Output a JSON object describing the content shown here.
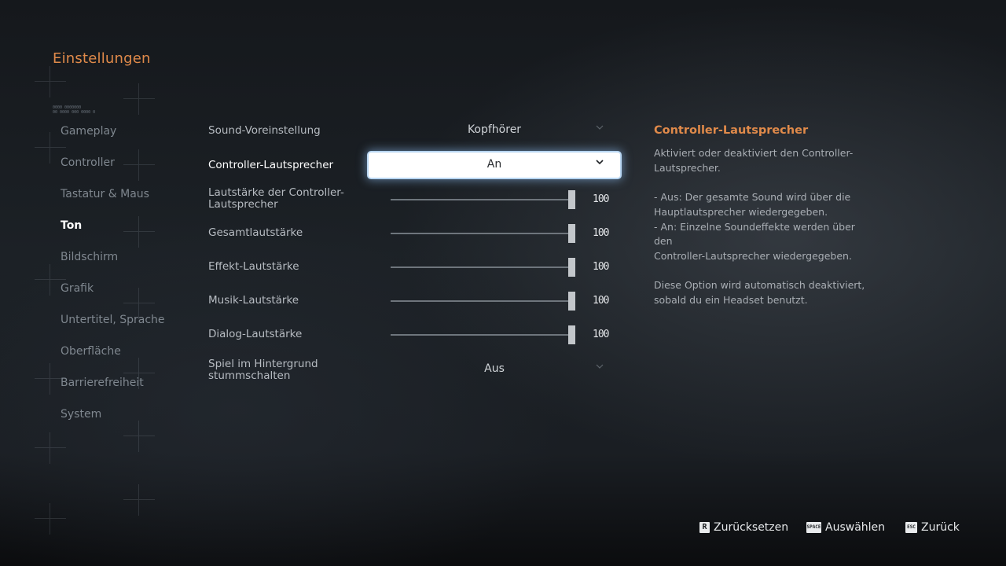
{
  "header": {
    "title": "Einstellungen",
    "code_text": [
      "0000 0000000",
      "00 0000 000 0000 0"
    ]
  },
  "sidebar": {
    "items": [
      {
        "label": "Gameplay",
        "active": false
      },
      {
        "label": "Controller",
        "active": false
      },
      {
        "label": "Tastatur & Maus",
        "active": false
      },
      {
        "label": "Ton",
        "active": true
      },
      {
        "label": "Bildschirm",
        "active": false
      },
      {
        "label": "Grafik",
        "active": false
      },
      {
        "label": "Untertitel, Sprache",
        "active": false
      },
      {
        "label": "Oberfläche",
        "active": false
      },
      {
        "label": "Barrierefreiheit",
        "active": false
      },
      {
        "label": "System",
        "active": false
      }
    ]
  },
  "settings": {
    "sound_preset": {
      "label": "Sound-Voreinstellung",
      "value": "Kopfhörer"
    },
    "controller_speaker": {
      "label": "Controller-Lautsprecher",
      "value": "An"
    },
    "controller_speaker_volume": {
      "label_line1": "Lautstärke der Controller-",
      "label_line2": "Lautsprecher",
      "value": "100",
      "level": 1.0
    },
    "master_volume": {
      "label": "Gesamtlautstärke",
      "value": "100",
      "level": 1.0
    },
    "effects_volume": {
      "label": "Effekt-Lautstärke",
      "value": "100",
      "level": 1.0
    },
    "music_volume": {
      "label": "Musik-Lautstärke",
      "value": "100",
      "level": 1.0
    },
    "dialog_volume": {
      "label": "Dialog-Lautstärke",
      "value": "100",
      "level": 1.0
    },
    "mute_background": {
      "label_line1": "Spiel im Hintergrund",
      "label_line2": "stummschalten",
      "value": "Aus"
    }
  },
  "description": {
    "title": "Controller-Lautsprecher",
    "lines": [
      "Aktiviert oder deaktiviert den Controller-",
      "Lautsprecher.",
      "",
      "- Aus: Der gesamte Sound wird über die",
      "Hauptlautsprecher wiedergegeben.",
      "- An: Einzelne Soundeffekte werden über den",
      "Controller-Lautsprecher wiedergegeben.",
      "",
      "Diese Option wird automatisch deaktiviert,",
      "sobald du ein Headset benutzt."
    ]
  },
  "footer": {
    "reset": {
      "key": "R",
      "label": "Zurücksetzen"
    },
    "select": {
      "key": "SPACE",
      "label": "Auswählen"
    },
    "back": {
      "key": "ESC",
      "label": "Zurück"
    }
  },
  "colors": {
    "accent": "#e08a4a",
    "focus_glow": "#b8d6f2",
    "active_text": "#ffffff",
    "inactive_text": "#7f878f"
  },
  "icons": {
    "dropdown": "chevron-down-icon"
  }
}
